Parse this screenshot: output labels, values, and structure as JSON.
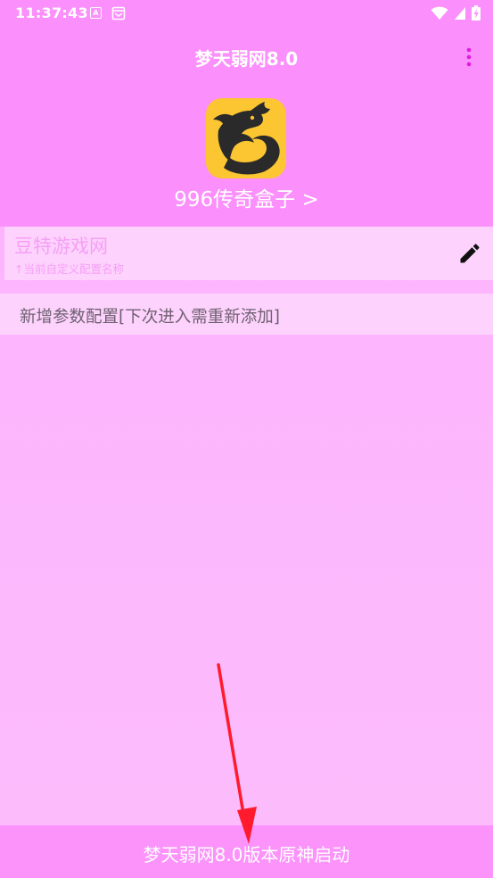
{
  "status_bar": {
    "time": "11:37:43",
    "a_icon_letter": "A"
  },
  "app_bar": {
    "title": "梦天弱网8.0"
  },
  "app": {
    "name": "996传奇盒子 >"
  },
  "config": {
    "name": "豆特游戏网",
    "hint": "↑当前自定义配置名称"
  },
  "add_config": {
    "label": "新增参数配置[下次进入需重新添加]"
  },
  "bottom": {
    "launch_label": "梦天弱网8.0版本原神启动"
  },
  "colors": {
    "header_bg": "#fb8ffb",
    "content_bg": "#fdb8fd",
    "card_bg": "#fdd3fd",
    "accent_text": "#f59ff5",
    "logo_bg": "#fcc532",
    "arrow": "#ff1a2e"
  }
}
